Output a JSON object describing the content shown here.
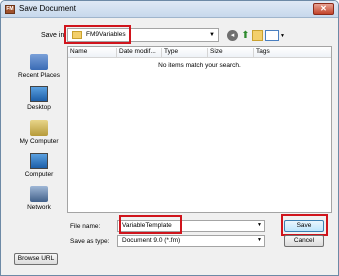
{
  "window": {
    "title": "Save Document",
    "app_icon_text": "FM"
  },
  "save_in": {
    "label": "Save in:",
    "value": "FM9Variables"
  },
  "places": [
    {
      "label": "Recent Places"
    },
    {
      "label": "Desktop"
    },
    {
      "label": "My Computer"
    },
    {
      "label": "Computer"
    },
    {
      "label": "Network"
    }
  ],
  "file_list": {
    "columns": [
      "Name",
      "Date modif...",
      "Type",
      "Size",
      "Tags"
    ],
    "empty_message": "No items match your search."
  },
  "file_name": {
    "label": "File name:",
    "value": "VariableTemplate"
  },
  "save_as_type": {
    "label": "Save as type:",
    "value": "Document 9.0 (*.fm)"
  },
  "buttons": {
    "save": "Save",
    "cancel": "Cancel",
    "browse_url": "Browse URL"
  },
  "colors": {
    "highlight_red": "#d0141c",
    "title_bar": "#c7d8ec"
  }
}
